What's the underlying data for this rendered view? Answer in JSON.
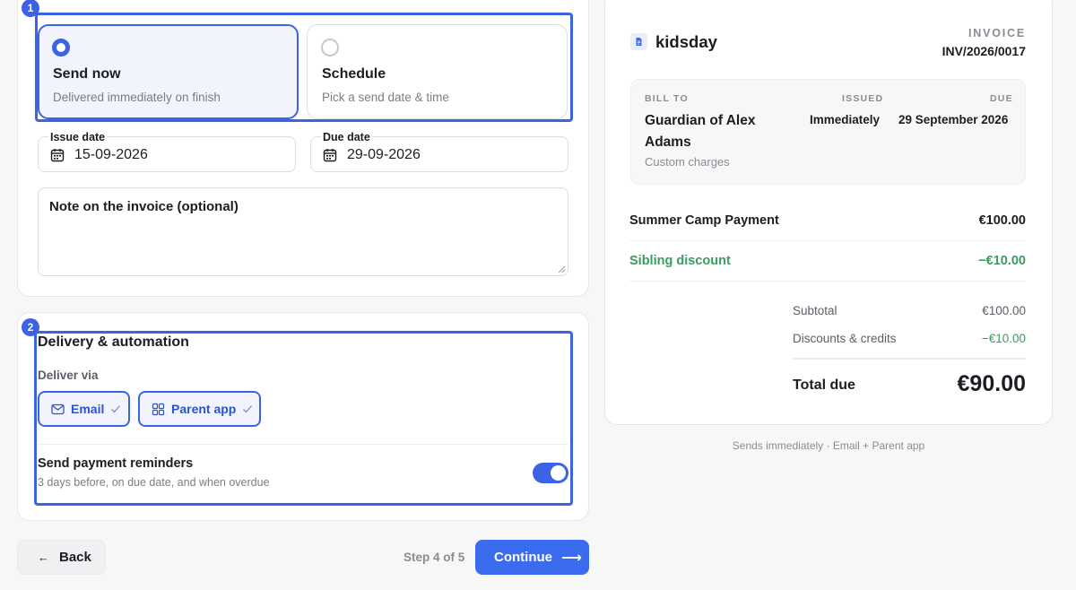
{
  "colors": {
    "accent": "#3b63e3",
    "success": "#3b9b61"
  },
  "markers": {
    "step1": "1",
    "step2": "2"
  },
  "send_options": {
    "now": {
      "title": "Send now",
      "subtitle": "Delivered immediately on finish",
      "selected": true
    },
    "schedule": {
      "title": "Schedule",
      "subtitle": "Pick a send date & time",
      "selected": false
    }
  },
  "dates": {
    "issue": {
      "label": "Issue date",
      "value": "15-09-2026",
      "icon": "calendar-icon"
    },
    "due": {
      "label": "Due date",
      "value": "29-09-2026",
      "icon": "calendar-icon"
    }
  },
  "note": {
    "placeholder": "Note on the invoice (optional)"
  },
  "delivery": {
    "title": "Delivery & automation",
    "deliver_via_label": "Deliver via",
    "channels": [
      {
        "label": "Email",
        "icon": "mail-icon",
        "checked": true
      },
      {
        "label": "Parent app",
        "icon": "grid-icon",
        "checked": true
      }
    ],
    "reminders": {
      "title": "Send payment reminders",
      "subtitle": "3 days before, on due date, and when overdue",
      "enabled": true
    }
  },
  "footer": {
    "back": "Back",
    "step": "Step 4 of 5",
    "continue": "Continue"
  },
  "invoice": {
    "brand": "kidsday",
    "label": "INVOICE",
    "number": "INV/2026/0017",
    "bill_to_label": "BILL TO",
    "bill_to_name": "Guardian of Alex Adams",
    "bill_to_sub": "Custom charges",
    "issued_label": "ISSUED",
    "issued_value": "Immediately",
    "due_label": "DUE",
    "due_value": "29 September 2026",
    "items": [
      {
        "name": "Summer Camp Payment",
        "amount": "€100.00"
      },
      {
        "name": "Sibling discount",
        "amount": "−€10.00"
      }
    ],
    "subtotal_label": "Subtotal",
    "subtotal_value": "€100.00",
    "discounts_label": "Discounts & credits",
    "discounts_value": "−€10.00",
    "total_label": "Total due",
    "total_value": "€90.00"
  },
  "sends_note": "Sends immediately · Email + Parent app"
}
